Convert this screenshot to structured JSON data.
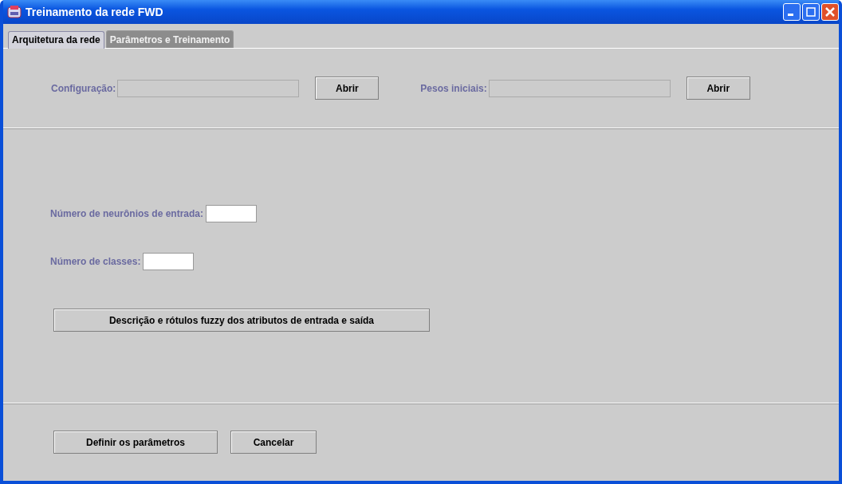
{
  "window": {
    "title": "Treinamento da rede FWD"
  },
  "tabs": [
    {
      "label": "Arquitetura da rede",
      "selected": true,
      "disabled": false
    },
    {
      "label": "Parâmetros e Treinamento",
      "selected": false,
      "disabled": true
    }
  ],
  "files": [
    {
      "label": "Configuração:",
      "disabled": true,
      "button": "Abrir"
    },
    {
      "label": "Pesos iniciais:",
      "disabled": true,
      "button": "Abrir"
    }
  ],
  "numbers": [
    {
      "label": "Número de neurônios de entrada:",
      "disabled": false
    },
    {
      "label": "Número de classes:",
      "disabled": false
    }
  ],
  "describe_button": "Descrição e rótulos fuzzy dos atributos de entrada e saída",
  "buttons": [
    "Definir os parâmetros",
    "Cancelar"
  ]
}
